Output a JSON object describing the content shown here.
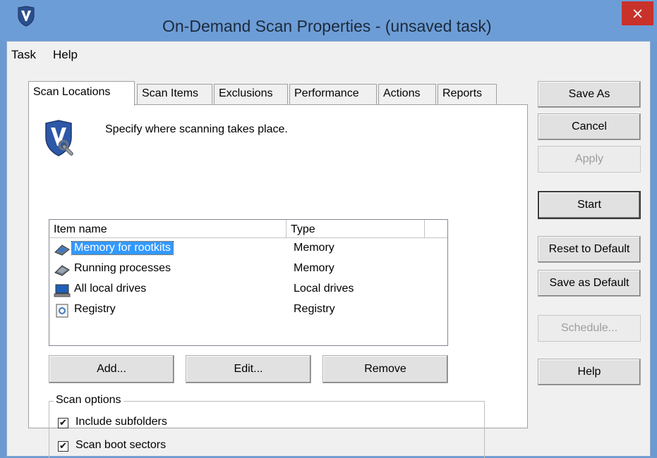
{
  "window": {
    "title": "On-Demand Scan Properties - (unsaved task)",
    "close_label": "×",
    "accent_color": "#6d9dd6",
    "close_color": "#c9312b"
  },
  "menu": {
    "items": [
      {
        "label": "Task"
      },
      {
        "label": "Help"
      }
    ]
  },
  "tabs": [
    {
      "label": "Scan Locations",
      "active": true
    },
    {
      "label": "Scan Items"
    },
    {
      "label": "Exclusions"
    },
    {
      "label": "Performance"
    },
    {
      "label": "Actions"
    },
    {
      "label": "Reports"
    }
  ],
  "panel": {
    "header_icon": "shield-wrench-icon",
    "header_text": "Specify where scanning takes place."
  },
  "list": {
    "columns": [
      "Item name",
      "Type"
    ],
    "rows": [
      {
        "name": "Memory for rootkits",
        "type": "Memory",
        "icon": "memory-chip-icon",
        "selected": true
      },
      {
        "name": "Running processes",
        "type": "Memory",
        "icon": "memory-chip-icon"
      },
      {
        "name": "All local drives",
        "type": "Local drives",
        "icon": "computer-icon"
      },
      {
        "name": "Registry",
        "type": "Registry",
        "icon": "registry-icon"
      }
    ]
  },
  "list_buttons": {
    "add": "Add...",
    "edit": "Edit...",
    "remove": "Remove"
  },
  "scan_options": {
    "legend": "Scan options",
    "include_subfolders": {
      "label": "Include subfolders",
      "checked": true
    },
    "scan_boot_sectors": {
      "label": "Scan boot sectors",
      "checked": true
    },
    "check_mark": "✔"
  },
  "side_buttons": {
    "save_as": "Save As",
    "cancel": "Cancel",
    "apply": "Apply",
    "start": "Start",
    "reset_default": "Reset to Default",
    "save_default": "Save as Default",
    "schedule": "Schedule...",
    "help": "Help"
  }
}
